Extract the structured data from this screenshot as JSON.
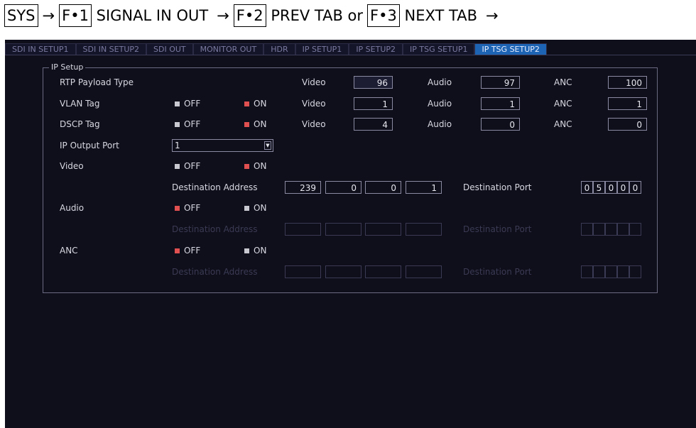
{
  "nav": {
    "sys": "SYS",
    "arrow": "→",
    "f1": "F•1",
    "f1_label": "SIGNAL IN OUT",
    "f2": "F•2",
    "f2_label": "PREV TAB or",
    "f3": "F•3",
    "f3_label": "NEXT TAB"
  },
  "tabs": [
    {
      "label": "SDI IN SETUP1"
    },
    {
      "label": "SDI IN SETUP2"
    },
    {
      "label": "SDI OUT"
    },
    {
      "label": "MONITOR OUT"
    },
    {
      "label": "HDR"
    },
    {
      "label": "IP SETUP1"
    },
    {
      "label": "IP SETUP2"
    },
    {
      "label": "IP TSG SETUP1"
    },
    {
      "label": "IP TSG SETUP2"
    }
  ],
  "active_tab": "IP TSG SETUP2",
  "group_title": "IP Setup",
  "rtp": {
    "label": "RTP Payload Type",
    "video_label": "Video",
    "video": "96",
    "audio_label": "Audio",
    "audio": "97",
    "anc_label": "ANC",
    "anc": "100"
  },
  "vlan": {
    "label": "VLAN Tag",
    "off": "OFF",
    "on": "ON",
    "video_label": "Video",
    "video": "1",
    "audio_label": "Audio",
    "audio": "1",
    "anc_label": "ANC",
    "anc": "1"
  },
  "dscp": {
    "label": "DSCP Tag",
    "off": "OFF",
    "on": "ON",
    "video_label": "Video",
    "video": "4",
    "audio_label": "Audio",
    "audio": "0",
    "anc_label": "ANC",
    "anc": "0"
  },
  "output_port": {
    "label": "IP Output Port",
    "value": "1"
  },
  "video": {
    "label": "Video",
    "off": "OFF",
    "on": "ON",
    "dest_addr_label": "Destination Address",
    "addr": [
      "239",
      "0",
      "0",
      "1"
    ],
    "dest_port_label": "Destination Port",
    "port": [
      "0",
      "5",
      "0",
      "0",
      "0"
    ]
  },
  "audio": {
    "label": "Audio",
    "off": "OFF",
    "on": "ON",
    "dest_addr_label": "Destination Address",
    "dest_port_label": "Destination Port"
  },
  "anc": {
    "label": "ANC",
    "off": "OFF",
    "on": "ON",
    "dest_addr_label": "Destination Address",
    "dest_port_label": "Destination Port"
  },
  "colors": {
    "background": "#0f0f1b",
    "active_tab": "#1e64b4",
    "radio_on": "#e05050",
    "radio_off": "#c8c8d0"
  }
}
